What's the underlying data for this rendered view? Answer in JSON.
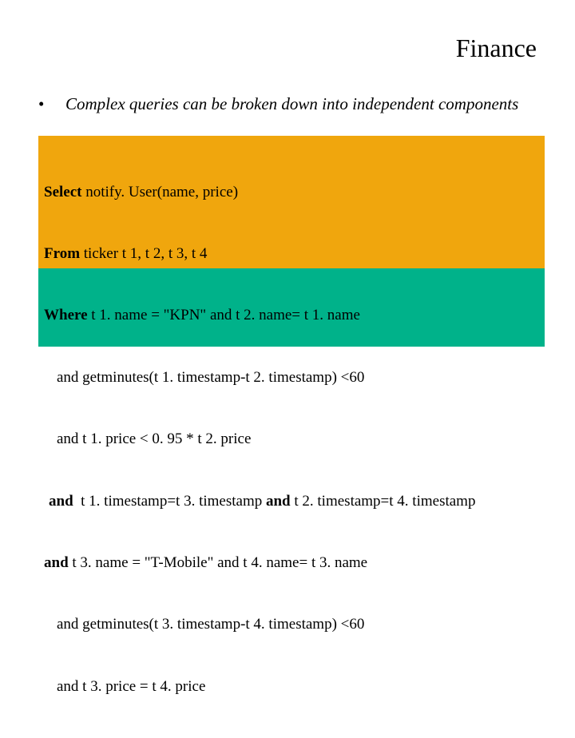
{
  "title": "Finance",
  "bullet": "Complex queries can be broken down into independent components",
  "code": {
    "l1a": "Select",
    "l1b": " notify. User(name, price)",
    "l2a": "From",
    "l2b": " ticker t 1, t 2, t 3, t 4",
    "l3a": "Where",
    "l3b": " t 1. name = \"KPN\" and t 2. name= t 1. name",
    "l4": "and getminutes(t 1. timestamp-t 2. timestamp) <60",
    "l5": "and t 1. price < 0. 95 * t 2. price",
    "l6a": "and",
    "l6b": "  t 1. timestamp=t 3. timestamp ",
    "l6c": "and",
    "l6d": " t 2. timestamp=t 4. timestamp",
    "l7a": "and",
    "l7b": " t 3. name = \"T-Mobile\" and t 4. name= t 3. name",
    "l8": "and getminutes(t 3. timestamp-t 4. timestamp) <60",
    "l9": "and t 3. price = t 4. price"
  }
}
